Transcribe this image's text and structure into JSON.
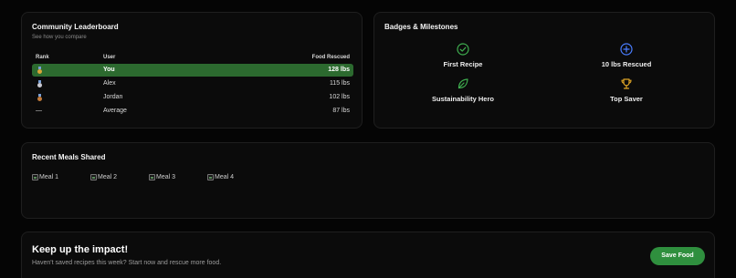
{
  "leaderboard": {
    "title": "Community Leaderboard",
    "subtitle": "See how you compare",
    "columns": {
      "rank": "Rank",
      "user": "User",
      "food": "Food Rescued"
    },
    "rows": [
      {
        "rank_icon": "gold-medal-icon",
        "rank": "",
        "user": "You",
        "food": "128 lbs",
        "highlight": true
      },
      {
        "rank_icon": "silver-medal-icon",
        "rank": "",
        "user": "Alex",
        "food": "115 lbs",
        "highlight": false
      },
      {
        "rank_icon": "bronze-medal-icon",
        "rank": "",
        "user": "Jordan",
        "food": "102 lbs",
        "highlight": false
      },
      {
        "rank_icon": "",
        "rank": "—",
        "user": "Average",
        "food": "87 lbs",
        "highlight": false
      }
    ],
    "colors": {
      "highlight": "#2c6a2f",
      "gold": "#d8a43a",
      "silver": "#c9c9d2",
      "bronze": "#c27a3a"
    }
  },
  "badges": {
    "title": "Badges & Milestones",
    "items": [
      {
        "label": "First Recipe",
        "icon": "check-circle-icon",
        "color": "#3fae4f"
      },
      {
        "label": "10 lbs Rescued",
        "icon": "plus-circle-icon",
        "color": "#4a7dff"
      },
      {
        "label": "Sustainability Hero",
        "icon": "leaf-icon",
        "color": "#3fae4f"
      },
      {
        "label": "Top Saver",
        "icon": "trophy-icon",
        "color": "#e0a526"
      }
    ]
  },
  "meals": {
    "title": "Recent Meals Shared",
    "items": [
      "Meal 1",
      "Meal 2",
      "Meal 3",
      "Meal 4"
    ]
  },
  "impact": {
    "title": "Keep up the impact!",
    "subtitle": "Haven't saved recipes this week? Start now and rescue more food.",
    "button_label": "Save Food",
    "button_color": "#2f8f3e"
  }
}
